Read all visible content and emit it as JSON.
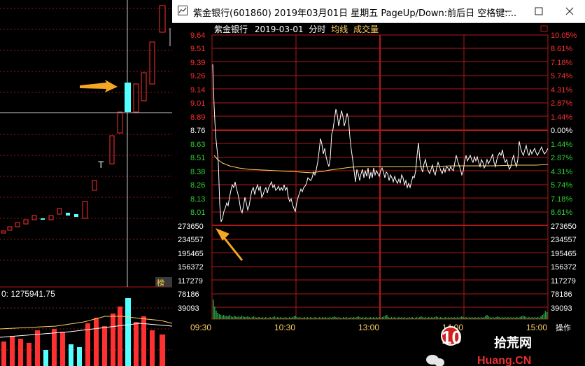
{
  "background_panel": {
    "indicator_label": "0: 1275941.75",
    "tab_label": "榜"
  },
  "window": {
    "title": "紫金银行(601860) 2019年03月01日 星期五 PageUp/Down:前后日 空格键:...",
    "minimize_icon": "minimize-icon",
    "maximize_icon": "maximize-icon",
    "close_icon": "close-icon"
  },
  "chart_header": {
    "name": "紫金银行",
    "date": "2019-03-01",
    "mode": "分时",
    "avg_label": "均线",
    "vol_label": "成交量"
  },
  "price_axis": [
    "9.64",
    "9.51",
    "9.39",
    "9.26",
    "9.14",
    "9.01",
    "8.89",
    "8.76",
    "8.63",
    "8.51",
    "8.38",
    "8.26",
    "8.13",
    "8.01"
  ],
  "pct_axis": [
    "10.05%",
    "8.61%",
    "7.18%",
    "5.74%",
    "4.31%",
    "2.87%",
    "1.44%",
    "0.00%",
    "1.44%",
    "2.87%",
    "4.31%",
    "5.74%",
    "7.18%",
    "8.61%"
  ],
  "volume_axis": [
    "273650",
    "234557",
    "195465",
    "156372",
    "117279",
    "78186",
    "39093"
  ],
  "time_axis": [
    "09:30",
    "10:30",
    "13:00",
    "14:00",
    "15:00"
  ],
  "time_corner_label": "操作",
  "watermark": {
    "line1": "拾荒网",
    "line2": "Huang.CN",
    "number": "10"
  },
  "colors": {
    "grid_red": "#b01818",
    "axis_red": "#ff3030",
    "axis_green": "#30d030",
    "price_line": "#ffffff",
    "avg_line": "#ffd060",
    "volume_bar": "#20a040",
    "arrow": "#f5a623",
    "up_candle": "#ff3030",
    "down_candle": "#54ffff"
  }
}
